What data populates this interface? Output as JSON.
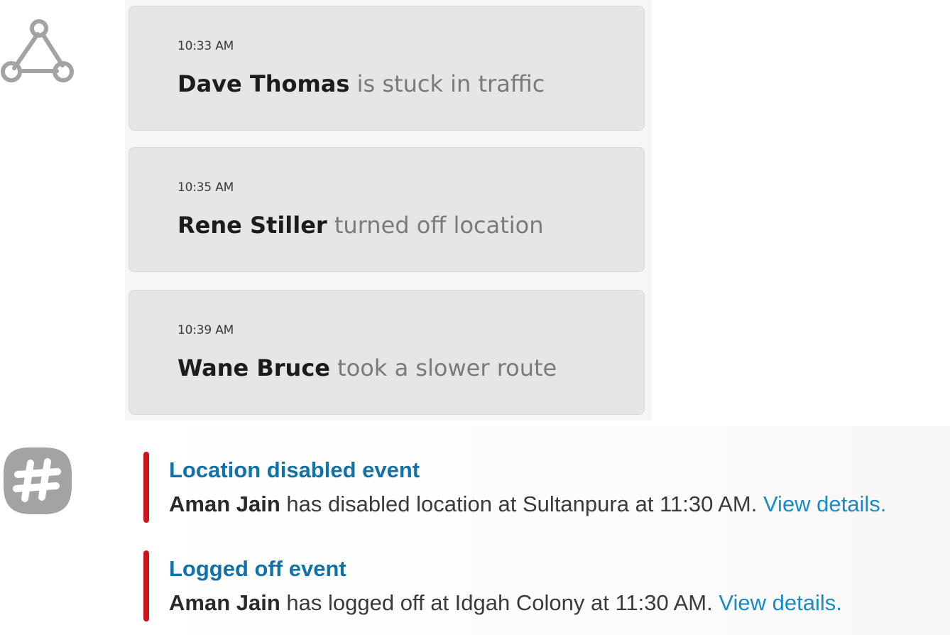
{
  "icons": {
    "integration": "graph-nodes-icon",
    "slack": "hash-icon"
  },
  "cards": [
    {
      "time": "10:33 AM",
      "name": "Dave Thomas",
      "text": " is stuck in traffic"
    },
    {
      "time": "10:35 AM",
      "name": "Rene Stiller",
      "text": " turned off location"
    },
    {
      "time": "10:39 AM",
      "name": "Wane Bruce",
      "text": " took a slower route"
    }
  ],
  "events": [
    {
      "title": "Location disabled event",
      "name": "Aman Jain",
      "text": " has disabled location at Sultanpura at 11:30 AM. ",
      "link": "View details."
    },
    {
      "title": "Logged off event",
      "name": "Aman Jain",
      "text": " has logged off at Idgah Colony at 11:30 AM. ",
      "link": "View details."
    }
  ],
  "colors": {
    "card_bg": "#e6e6e6",
    "event_bar": "#d0121b",
    "event_title": "#1271a8",
    "link": "#1a8ac7",
    "icon_gray": "#a3a3a3"
  }
}
